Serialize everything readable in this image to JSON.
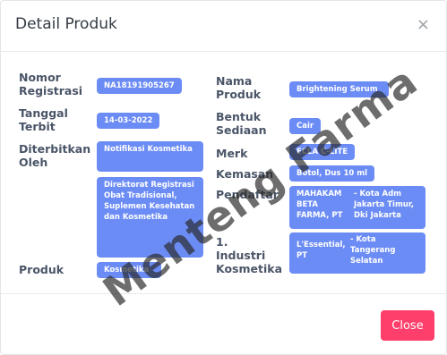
{
  "modal": {
    "title": "Detail Produk",
    "close_icon": "×",
    "close_button": "Close"
  },
  "labels": {
    "nomor_registrasi": "Nomor Registrasi",
    "tanggal_terbit": "Tanggal Terbit",
    "diterbitkan_oleh": "Diterbitkan Oleh",
    "produk": "Produk",
    "nama_produk": "Nama Produk",
    "bentuk_sediaan": "Bentuk Sediaan",
    "merk": "Merk",
    "kemasan": "Kemasan",
    "pendaftar": "Pendaftar",
    "industri_kosmetika": "1. Industri Kosmetika"
  },
  "values": {
    "nomor_registrasi": "NA18191905267",
    "tanggal_terbit": "14-03-2022",
    "diterbitkan_oleh_1": "Notifikasi Kosmetika",
    "diterbitkan_oleh_2": "Direktorat Registrasi Obat Tradisional, Suplemen Kesehatan dan Kosmetika",
    "produk": "Kosmetika",
    "nama_produk": "Brightening Serum",
    "bentuk_sediaan": "Cair",
    "merk": "ECLA C-LITE",
    "kemasan": "Botol, Dus 10 ml",
    "pendaftar": "MAHAKAM BETA FARMA, PT",
    "pendaftar_alamat": "- Kota Adm Jakarta Timur, Dki Jakarta",
    "industri": "L'Essential, PT",
    "industri_alamat": "- Kota Tangerang Selatan"
  },
  "watermark": "Menteng Farma",
  "colors": {
    "badge": "#6c8cf5",
    "close_button": "#ff3f6b",
    "label": "#4a5568"
  }
}
